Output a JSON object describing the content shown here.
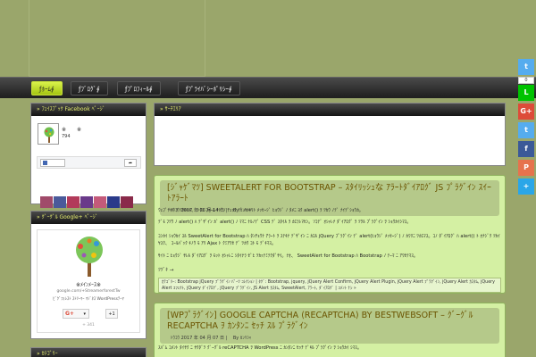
{
  "nav": {
    "items": [
      {
        "label": "ƒﾎｰﾑ∮"
      },
      {
        "label": "ƒﾌﾞﾛｸﾞ∮"
      },
      {
        "label": "ƒﾌﾟﾛﾌｨｰﾙ∮"
      },
      {
        "label": "ƒﾌﾟﾗｲﾊﾞｼｰﾎﾟﾘｼｰ∮"
      }
    ]
  },
  "sidebar": {
    "facebook": {
      "title": "ﾌｪｲｽﾌﾞｯｸ Facebook ﾍﾟｰｼﾞ",
      "name": "※　　※",
      "count": "794"
    },
    "googleplus": {
      "title": "ｸﾞｰｸﾞﾙ Google+ ﾍﾟｰｼﾞ",
      "name": "※ﾒｲﾝﾒｰｽ※",
      "url": "google.com/+StreamerforestTw",
      "desc": "ﾋﾞｸﾞﾌｫﾚｽﾄ ｽﾄﾘｰﾏｰ ﾏｼﾞﾈｽ WordPressﾃｰﾏ",
      "follow": "G+",
      "plusone": "+1",
      "followers": "+ 341"
    },
    "bottom": {
      "title": "ｶﾃｺﾞﾘｰ"
    }
  },
  "main": {
    "box_title": "ｻｰﾁｴﾘｱ",
    "posts": [
      {
        "title": "[ｼﾞｬｹﾞﾏﾂ] SWEETALERT FOR BOOTSTRAP – ｽﾀｲﾘｯｼｭな ｱﾗｰﾄﾀﾞｲｱﾛｸﾞ JS ﾌﾟﾗｸﾞｲﾝ ｽｲｰﾄｱﾗｰﾄ",
        "date": "ﾄｳｺｳ 2017 年 06 月 14 日 | 　By ｶﾝﾘｼｬ",
        "paragraphs": [
          "ｳｪﾌﾞｻｲﾄ ｦ ﾂｸﾙﾄｷ、 ﾄｸﾆ ﾌｫｰﾑ ﾅﾄﾞﾉ ﾁｪｯｸ ﾃﾞ ﾊｯｷﾘﾄ ﾒｯｾｰｼﾞ ﾋｮｳｼﾞ ﾉ ﾀﾒﾆ ﾖｸ alert() ｦ ﾂｶｳ ﾉﾃﾞ ﾅｲﾃﾞｼｮｳｶ。",
          "ﾃﾞﾓ ﾌﾂｳ ﾉ alert() ﾊ ﾃﾞｻﾞｲﾝ ｶﾞ alert() ﾉ ﾏﾏﾆ ﾅﾙﾉﾃﾞ CSS ﾃﾞ ｽﾀｲﾙ ｦ ｶｴﾗﾚﾏｾﾝ。ｿｺﾃﾞ ｵｼｬﾚﾅ ﾀﾞｲｱﾛｸﾞ ｦ ﾂｸﾙ ﾌﾟﾗｸﾞｲﾝ ｦ ｼｮｳｶｲｼﾏｽ。",
          "ｺﾝｶｲ ｼｮｳｶｲ ｽﾙ SweetAlert for Bootstrap ﾊ ﾀﾝﾁｮｳﾅ ｱﾗｰﾄ ｦ ｽﾃｷﾅ ﾃﾞｻﾞｲﾝ ﾆ ｶｴﾙ jQuery ﾌﾟﾗｸﾞｲﾝ ﾃﾞ alert(ﾋｮｳｼﾞ ﾒｯｾｰｼﾞ) ﾉ ｶﾜﾘﾆ ﾂｶｴﾏｽ。ｺﾉ ﾀﾞｲｱﾛｸﾞ ﾊ alert() ﾄ ｵﾅｼﾞｸ ﾂｶｲﾔｽｸ、 ｺｰﾙﾊﾞｯｸ ｷﾉｳ ﾓ ｱﾘ Ajax ﾄ ｸﾐｱﾜｾ ﾃﾞ ﾂｶｳ ｺﾄ ﾓ ﾃﾞｷﾏｽ。",
          "ｻｲﾄ ﾆ ﾋｮｳｼﾞ ｻﾚﾙ ﾀﾞｲｱﾛｸﾞ ｦ ﾓｯﾄ ｵｼｬﾚﾆ ｼﾀｲﾅﾗ ｾﾞﾋ ﾂｶｯﾃﾐﾃｸﾀﾞｻｲ。ﾅｵ、 SweetAlert for Bootstrap ﾊ Bootstrap ﾉ ﾃｰﾏ ﾆ ｱﾜｾﾃﾏｽ。"
        ],
        "more": "ﾂﾂﾞｷ →",
        "tags": "ｶﾃｺﾞﾘｰ: Bootstrap jQuery ﾌﾟﾗｸﾞｲﾝ ﾊﾟｰﾂ ｺﾚｸｼｮﾝ | ﾀｸﾞ: Bootstrap, jquery, jQuery Alert Confirm, jQuery Alert Plugin, jQuery Alert ﾌﾟﾗｸﾞｲﾝ, jQuery Alert ｶｽﾀﾑ, jQuery Alert ｴﾌｪｸﾄ, jQuery ﾀﾞｲｱﾛｸﾞ, jQuery ﾌﾟﾗｸﾞｲﾝ, JS Alert ｶｽﾀﾑ, SweetAlert, ｱﾗｰﾄ, ﾀﾞｲｱﾛｸﾞ | ｺﾒﾝﾄ ﾅｼ »"
      },
      {
        "title": "[WPﾌﾟﾗｸﾞｲﾝ] GOOGLE CAPTCHA (RECAPTCHA) BY BESTWEBSOFT – ｸﾞｰｸﾞﾙ RECAPTCHA ｦ ｶﾝﾀﾝﾆ ｾｯﾁ ｽﾙ ﾌﾟﾗｸﾞｲﾝ",
        "date": "ﾄｳｺｳ 2017 年 04 月 07 日 | 　By ｶﾝﾘｼｬ",
        "paragraphs": [
          "ｽﾊﾟﾑ ｺﾒﾝﾄ ﾀｲｻｸ ﾆ ﾔｸﾀﾞﾂ ｸﾞｰｸﾞﾙ reCAPTCHA ｦ WordPress ﾆ ｶﾝﾀﾝﾆ ｾｯﾁ ﾃﾞｷﾙ ﾌﾟﾗｸﾞｲﾝ ｦ ｼｮｳｶｲ ｼﾏｽ。"
        ]
      }
    ]
  },
  "share": {
    "count": "0",
    "buttons": [
      {
        "icon": "twitter-icon",
        "glyph": "t",
        "color": "#55acee"
      },
      {
        "icon": "line-icon",
        "glyph": "L",
        "color": "#00c300"
      },
      {
        "icon": "googleplus-icon",
        "glyph": "G+",
        "color": "#dd4b39"
      },
      {
        "icon": "twitter-icon",
        "glyph": "t",
        "color": "#55acee"
      },
      {
        "icon": "facebook-icon",
        "glyph": "f",
        "color": "#3b5998"
      },
      {
        "icon": "mix-icon",
        "glyph": "P",
        "color": "#e6734d"
      },
      {
        "icon": "more-icon",
        "glyph": "+",
        "color": "#2aa6e8"
      }
    ]
  },
  "colors": {
    "page_bg": "#9aa66b",
    "nav_active": "#b8d51f",
    "post_bg": "#d4f0a3",
    "post_title": "#6b5400"
  }
}
